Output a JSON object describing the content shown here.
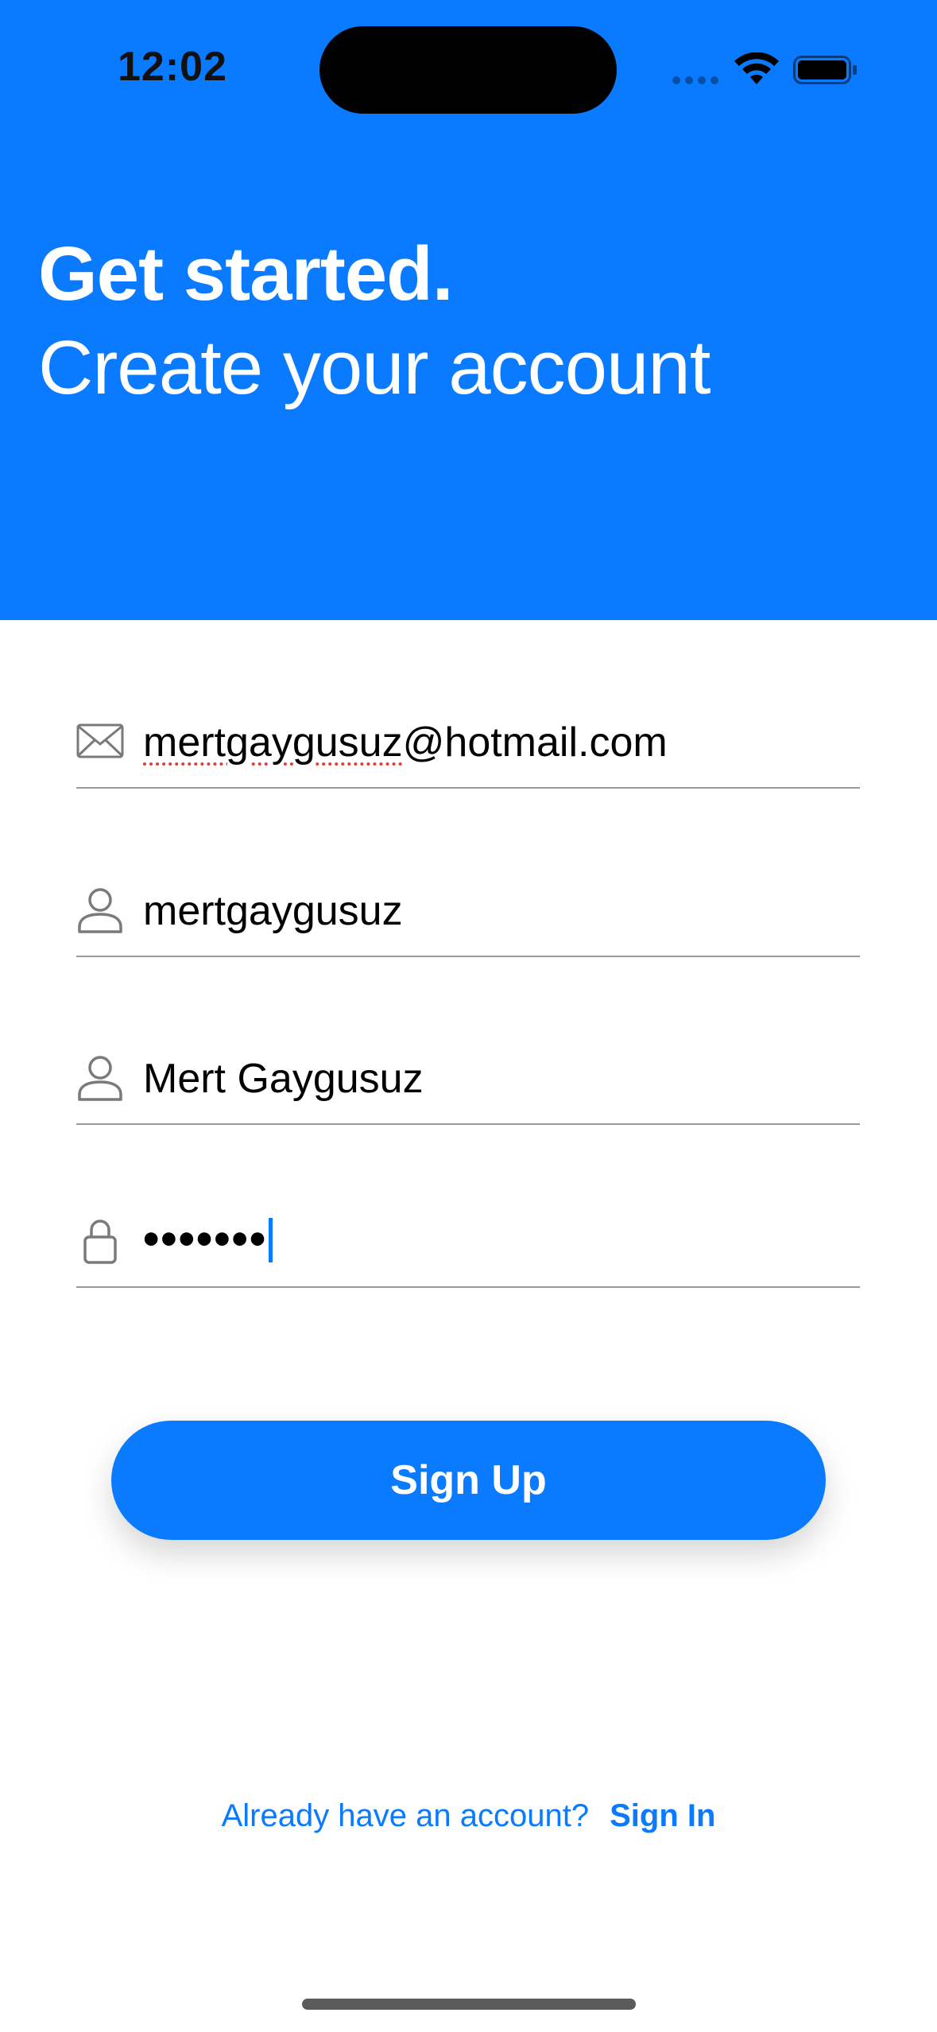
{
  "status_bar": {
    "time": "12:02"
  },
  "header": {
    "title": "Get started.",
    "subtitle": "Create your account",
    "background_color": "#0a7aff"
  },
  "form": {
    "email": {
      "icon": "envelope-icon",
      "value": "mertgaygusuz@hotmail.com",
      "misspelled_part": "mertgaygusuz",
      "rest": "@hotmail.com"
    },
    "username": {
      "icon": "person-icon",
      "value": "mertgaygusuz"
    },
    "full_name": {
      "icon": "person-icon",
      "value": "Mert Gaygusuz"
    },
    "password": {
      "icon": "lock-icon",
      "value": "•••••••"
    }
  },
  "signup_button": {
    "label": "Sign Up",
    "color": "#0a7aff"
  },
  "footer": {
    "prompt": "Already have an account?",
    "link": "Sign In"
  }
}
